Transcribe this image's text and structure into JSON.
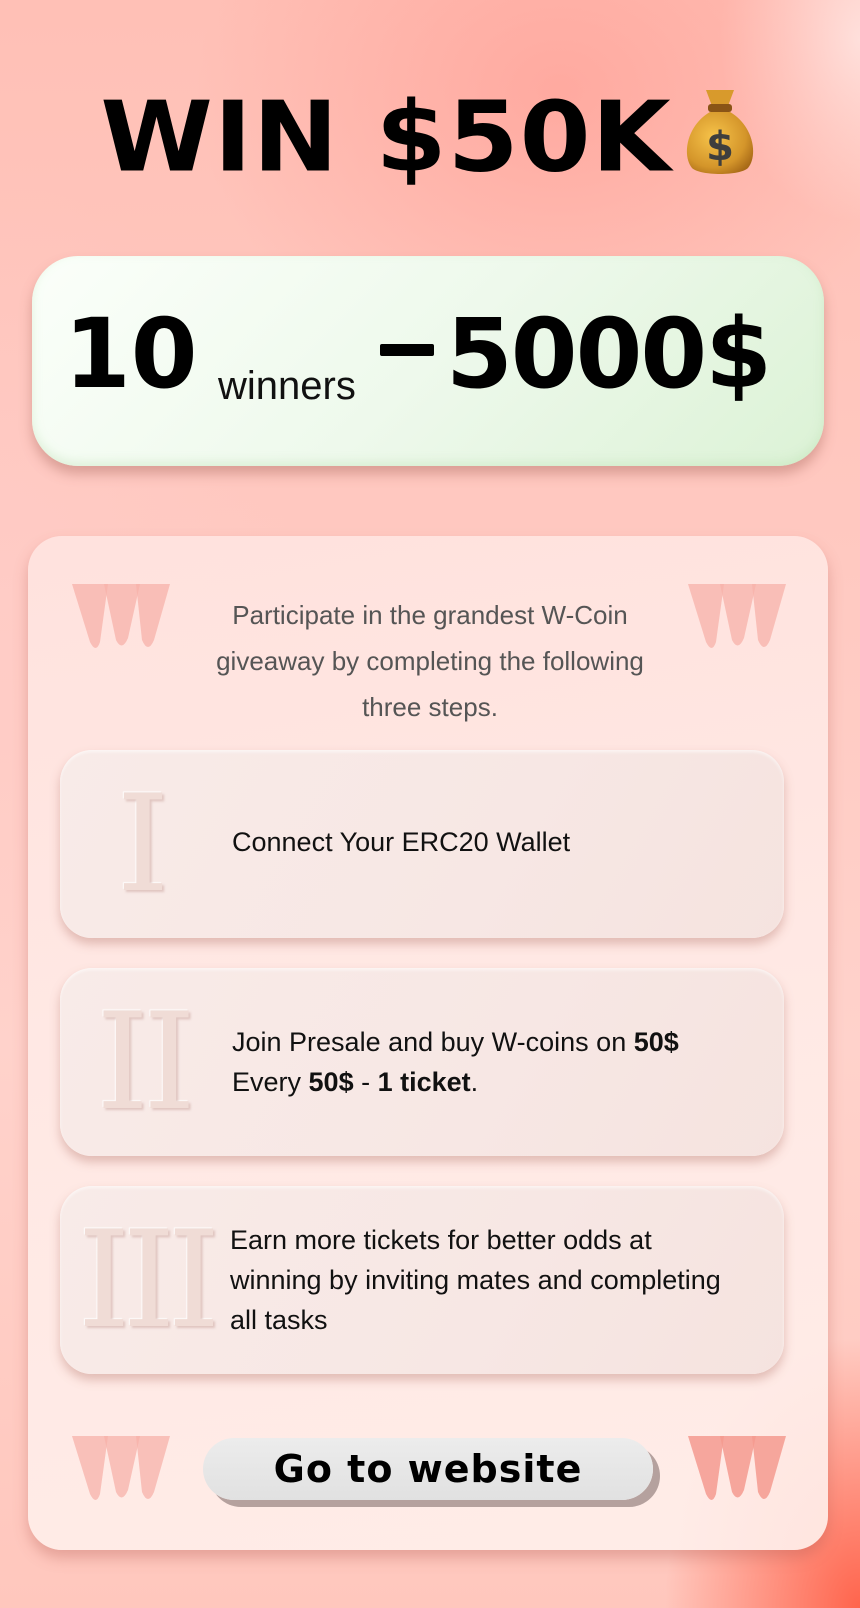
{
  "header": {
    "title": "WIN $50K",
    "title_icon": "money-bag-icon"
  },
  "prize": {
    "winner_count": "10",
    "winner_unit": "winners",
    "separator": "–",
    "amount": "5000$"
  },
  "steps_panel": {
    "intro": "Participate in the grandest W-Coin giveaway by completing the following three steps.",
    "corner_icon": "w-coin-logo-icon",
    "steps": [
      {
        "numeral": "I",
        "text": "Connect Your ERC20 Wallet"
      },
      {
        "numeral": "II",
        "text_prefix": "Join Presale and buy W-coins on ",
        "text_bold_1": "50$",
        "text_mid": "Every ",
        "text_bold_2": "50$",
        "text_dash": " - ",
        "text_bold_3": "1 ticket",
        "text_suffix": "."
      },
      {
        "numeral": "III",
        "text": "Earn more tickets for better odds at winning by inviting mates and completing all tasks"
      }
    ],
    "cta_label": "Go to website"
  },
  "colors": {
    "background": "#ffc7bd",
    "prize_card": "#eef9ec",
    "panel": "#ffe8e4",
    "step_card": "#f7e7e4",
    "button": "#e6e6e6",
    "logo": "#f6a59c"
  }
}
